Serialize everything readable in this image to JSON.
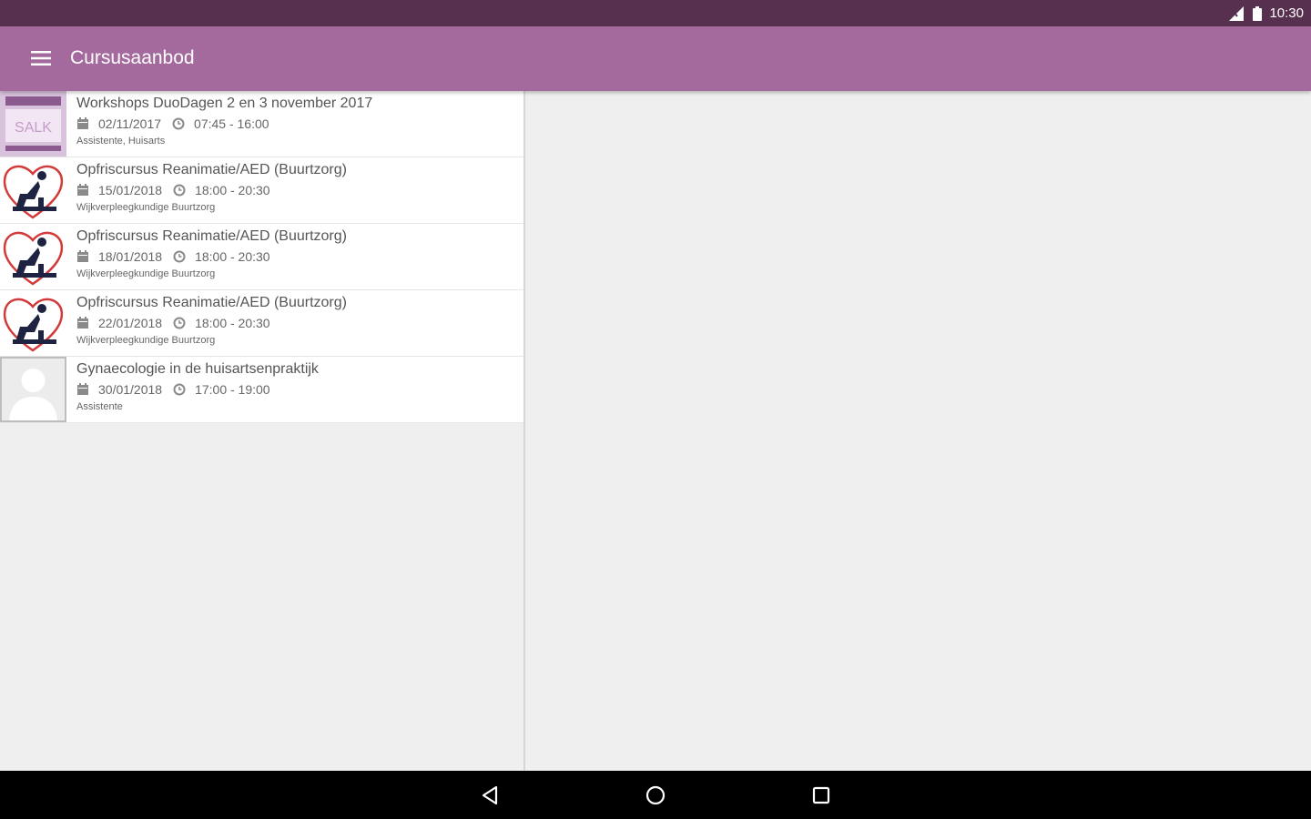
{
  "status_bar": {
    "time": "10:30",
    "icons": [
      "signal-icon",
      "battery-icon"
    ]
  },
  "app_bar": {
    "title": "Cursusaanbod",
    "menu_icon": "hamburger-menu-icon"
  },
  "courses": [
    {
      "title": "Workshops DuoDagen 2 en 3 november 2017",
      "date": "02/11/2017",
      "time": "07:45 - 16:00",
      "audience": "Assistente, Huisarts",
      "thumbnail": "event-poster"
    },
    {
      "title": "Opfriscursus Reanimatie/AED (Buurtzorg)",
      "date": "15/01/2018",
      "time": "18:00 - 20:30",
      "audience": "Wijkverpleegkundige Buurtzorg",
      "thumbnail": "cpr-heart"
    },
    {
      "title": "Opfriscursus Reanimatie/AED (Buurtzorg)",
      "date": "18/01/2018",
      "time": "18:00 - 20:30",
      "audience": "Wijkverpleegkundige Buurtzorg",
      "thumbnail": "cpr-heart"
    },
    {
      "title": "Opfriscursus Reanimatie/AED (Buurtzorg)",
      "date": "22/01/2018",
      "time": "18:00 - 20:30",
      "audience": "Wijkverpleegkundige Buurtzorg",
      "thumbnail": "cpr-heart"
    },
    {
      "title": "Gynaecologie in de huisartsenpraktijk",
      "date": "30/01/2018",
      "time": "17:00 - 19:00",
      "audience": "Assistente",
      "thumbnail": "person-placeholder"
    }
  ],
  "nav_bar": {
    "buttons": [
      "back-icon",
      "home-icon",
      "recents-icon"
    ]
  },
  "colors": {
    "status_bar": "#58304f",
    "app_bar": "#a56a9d",
    "background": "#efefef",
    "nav_bar": "#000000",
    "cpr_heart": "#d33a3a",
    "cpr_figure": "#1d2340"
  }
}
